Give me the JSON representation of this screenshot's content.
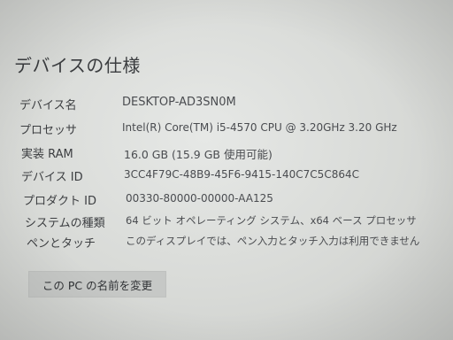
{
  "section": {
    "title": "デバイスの仕様"
  },
  "specs": [
    {
      "label": "デバイス名",
      "value": "DESKTOP-AD3SN0M"
    },
    {
      "label": "プロセッサ",
      "value": "Intel(R) Core(TM) i5-4570 CPU @ 3.20GHz   3.20 GHz"
    },
    {
      "label": "実装 RAM",
      "value": "16.0 GB (15.9 GB 使用可能)"
    },
    {
      "label": "デバイス ID",
      "value": "3CC4F79C-48B9-45F6-9415-140C7C5C864C"
    },
    {
      "label": "プロダクト ID",
      "value": "00330-80000-00000-AA125"
    },
    {
      "label": "システムの種類",
      "value": "64 ビット オペレーティング システム、x64 ベース プロセッサ"
    },
    {
      "label": "ペンとタッチ",
      "value": "このディスプレイでは、ペン入力とタッチ入力は利用できません"
    }
  ],
  "actions": {
    "rename_pc_label": "この PC の名前を変更"
  }
}
